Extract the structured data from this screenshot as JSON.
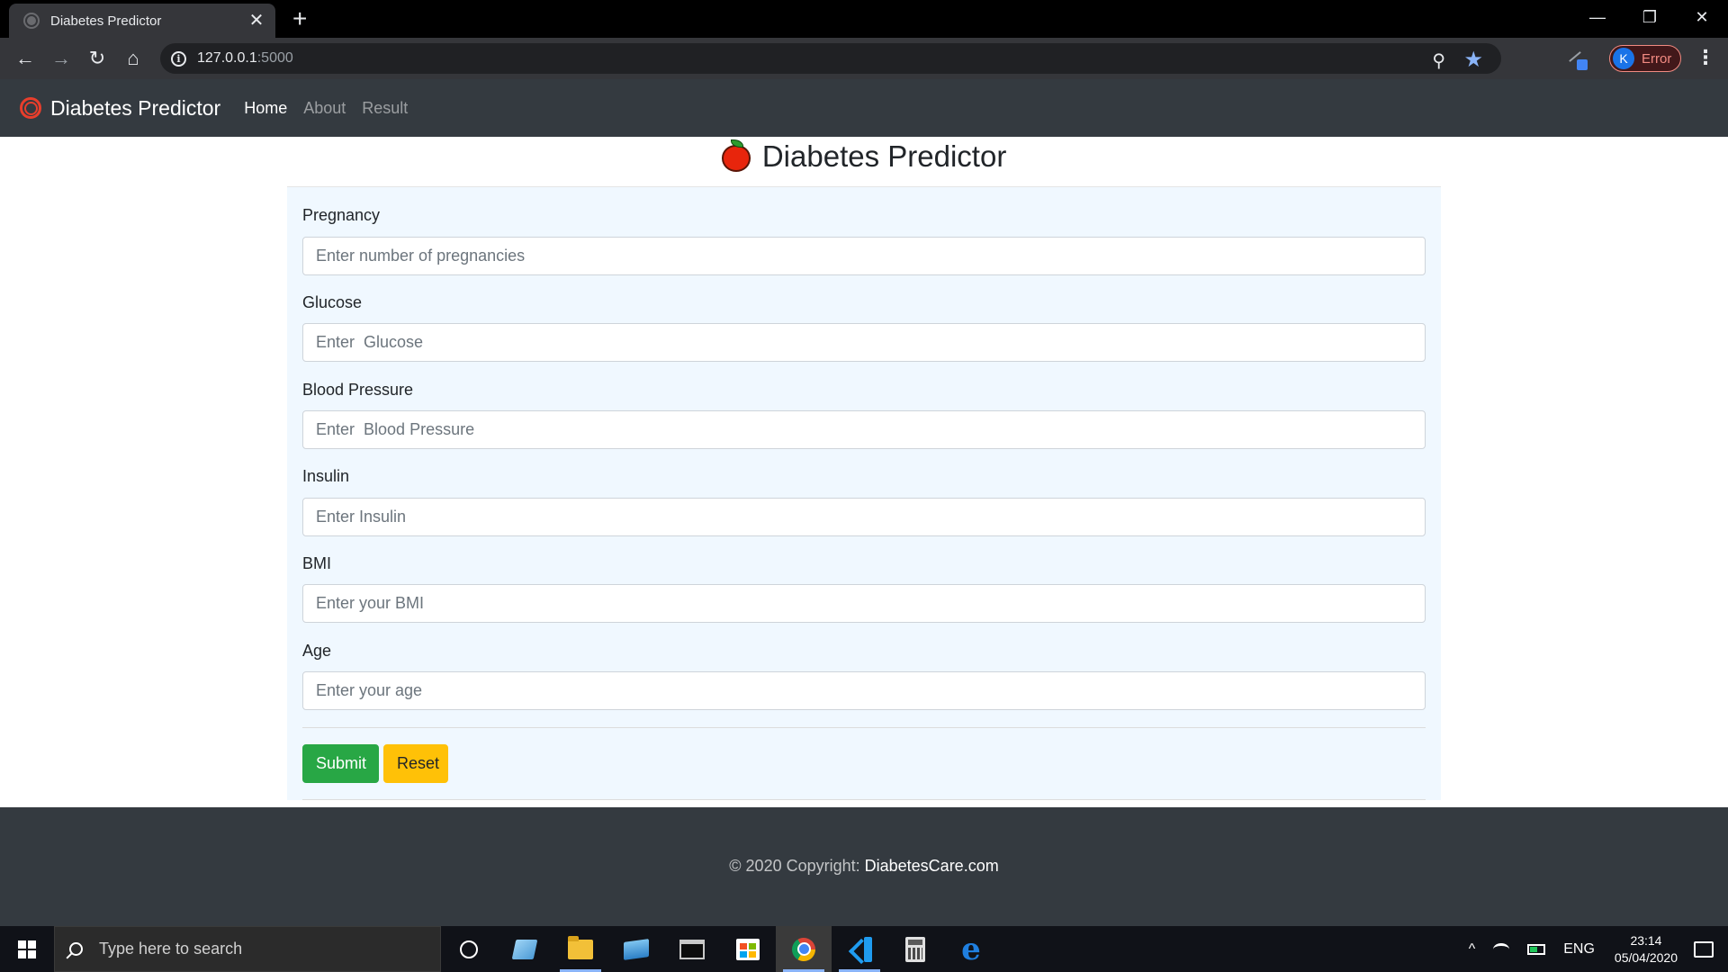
{
  "browser": {
    "tab_title": "Diabetes Predictor",
    "tab_close_glyph": "✕",
    "new_tab_glyph": "+",
    "url_host": "127.0.0.1",
    "url_port": ":5000",
    "profile_initial": "K",
    "profile_status": "Error",
    "icons": [
      "back-icon",
      "forward-icon",
      "reload-icon",
      "home-icon",
      "info-icon",
      "zoom-icon",
      "star-icon",
      "extension-icon",
      "menu-icon"
    ],
    "colors": {
      "tabstrip": "#000000",
      "toolbar": "#35363a",
      "omnibox": "#202124",
      "star": "#8ab4f8",
      "profile_error": "#f28b82"
    }
  },
  "navbar": {
    "brand": "Diabetes Predictor",
    "links": [
      {
        "label": "Home",
        "active": true
      },
      {
        "label": "About",
        "active": false
      },
      {
        "label": "Result",
        "active": false
      }
    ],
    "colors": {
      "background": "#343a40",
      "brand_icon": "#e83e2c"
    }
  },
  "page": {
    "title": "Diabetes Predictor",
    "title_icon": "apple-icon"
  },
  "form": {
    "fields": [
      {
        "label": "Pregnancy",
        "placeholder": "Enter number of pregnancies",
        "value": ""
      },
      {
        "label": "Glucose",
        "placeholder": "Enter  Glucose",
        "value": ""
      },
      {
        "label": "Blood Pressure",
        "placeholder": "Enter  Blood Pressure",
        "value": ""
      },
      {
        "label": "Insulin",
        "placeholder": "Enter Insulin",
        "value": ""
      },
      {
        "label": "BMI",
        "placeholder": "Enter your BMI",
        "value": ""
      },
      {
        "label": "Age",
        "placeholder": "Enter your age",
        "value": ""
      }
    ],
    "submit_label": "Submit",
    "reset_label": "Reset",
    "colors": {
      "card_background": "#f0f8ff",
      "submit": "#28a745",
      "reset": "#ffc107"
    }
  },
  "footer": {
    "copyright": "© 2020 Copyright: ",
    "link": "DiabetesCare.com"
  },
  "taskbar": {
    "search_placeholder": "Type here to search",
    "apps": [
      "cortana-icon",
      "task-view-icon",
      "file-explorer-icon",
      "this-pc-icon",
      "terminal-icon",
      "store-icon",
      "chrome-icon",
      "vscode-icon",
      "calculator-icon",
      "edge-icon"
    ],
    "tray_caret": "^",
    "language": "ENG",
    "time": "23:14",
    "date": "05/04/2020"
  }
}
